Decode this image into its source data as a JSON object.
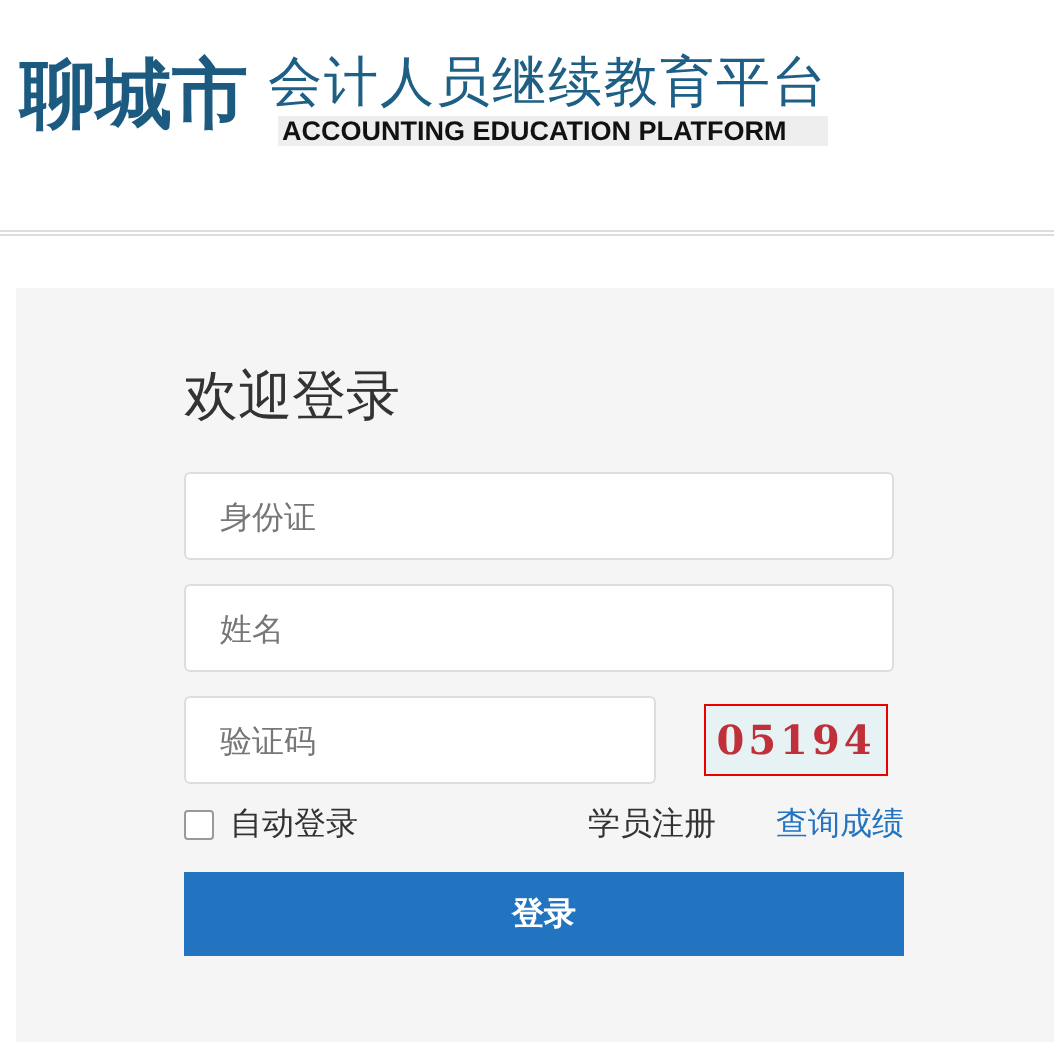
{
  "header": {
    "city": "聊城市",
    "title": "会计人员继续教育平台",
    "subtitle": "ACCOUNTING EDUCATION PLATFORM"
  },
  "login": {
    "heading": "欢迎登录",
    "fields": [
      {
        "placeholder": "身份证"
      },
      {
        "placeholder": "姓名"
      }
    ],
    "captcha_field": {
      "placeholder": "验证码"
    },
    "captcha": "05194",
    "auto_login": {
      "label": "自动登录",
      "checked": false
    },
    "links": [
      {
        "label": "学员注册",
        "kind": "plain"
      },
      {
        "label": "查询成绩",
        "kind": "link"
      }
    ],
    "submit": "登录"
  }
}
